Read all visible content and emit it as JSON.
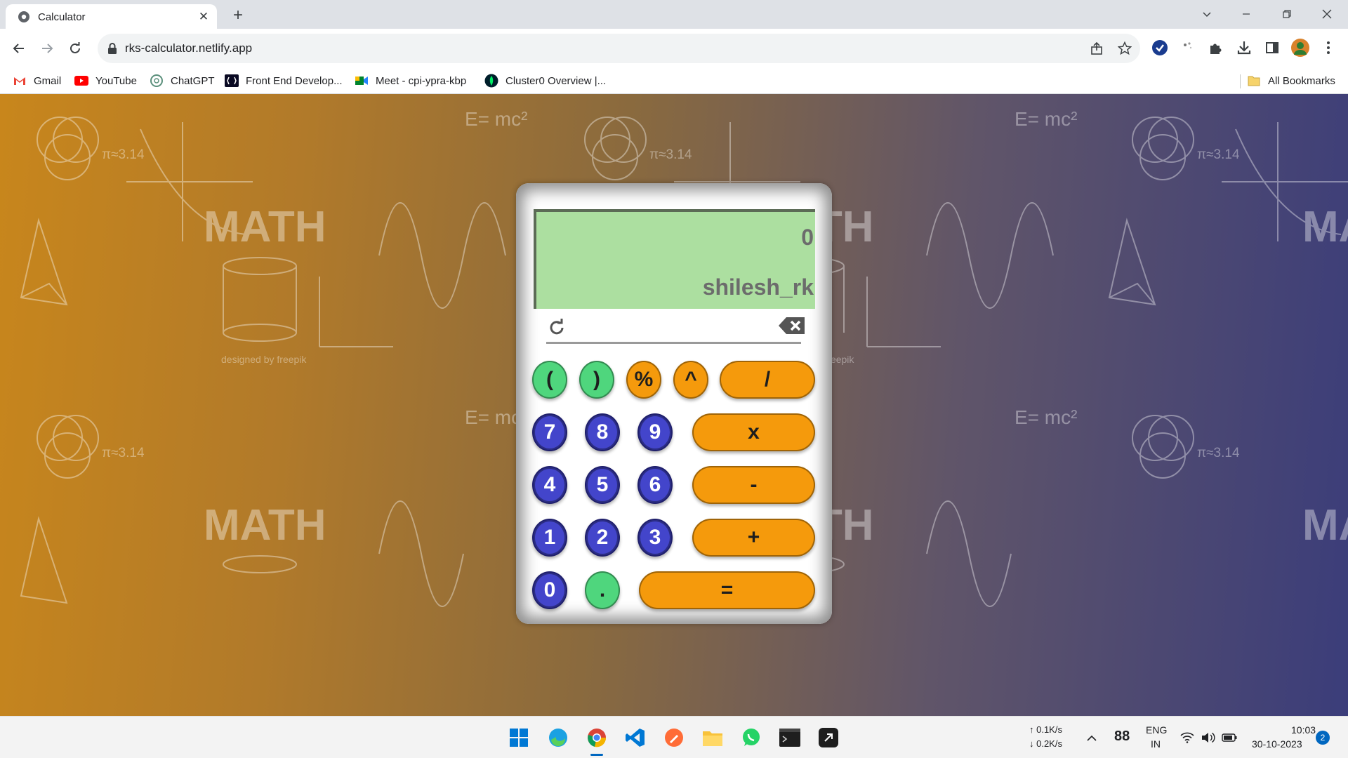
{
  "browser": {
    "tab_title": "Calculator",
    "new_tab_label": "+",
    "url": "rks-calculator.netlify.app"
  },
  "bookmarks": [
    {
      "label": "Gmail",
      "icon": "gmail-icon"
    },
    {
      "label": "YouTube",
      "icon": "youtube-icon"
    },
    {
      "label": "ChatGPT",
      "icon": "chatgpt-icon"
    },
    {
      "label": "Front End Develop...",
      "icon": "frontend-icon"
    },
    {
      "label": "Meet - cpi-ypra-kbp",
      "icon": "meet-icon"
    },
    {
      "label": "Cluster0 Overview |...",
      "icon": "mongodb-icon"
    }
  ],
  "all_bookmarks_label": "All Bookmarks",
  "calculator": {
    "display_value": "0",
    "display_name": "shilesh_rk",
    "keys": {
      "open_paren": "(",
      "close_paren": ")",
      "percent": "%",
      "power": "^",
      "divide": "/",
      "seven": "7",
      "eight": "8",
      "nine": "9",
      "multiply": "x",
      "four": "4",
      "five": "5",
      "six": "6",
      "subtract": "-",
      "one": "1",
      "two": "2",
      "three": "3",
      "add": "+",
      "zero": "0",
      "decimal": ".",
      "equals": "="
    }
  },
  "background": {
    "doodle_words": {
      "math": "MATH",
      "emc": "E= mc²",
      "pi": "π≈3.14",
      "freepik": "designed by freepik"
    }
  },
  "taskbar": {
    "net_up": "↑ 0.1K/s",
    "net_down": "↓ 0.2K/s",
    "weather": "88",
    "lang_top": "ENG",
    "lang_bottom": "IN",
    "time": "10:03",
    "date": "30-10-2023",
    "notification_count": "2"
  },
  "colors": {
    "display_bg": "#acdfa0",
    "key_green": "#4fd67d",
    "key_orange": "#f59a0c",
    "key_blue": "#4345cb"
  }
}
